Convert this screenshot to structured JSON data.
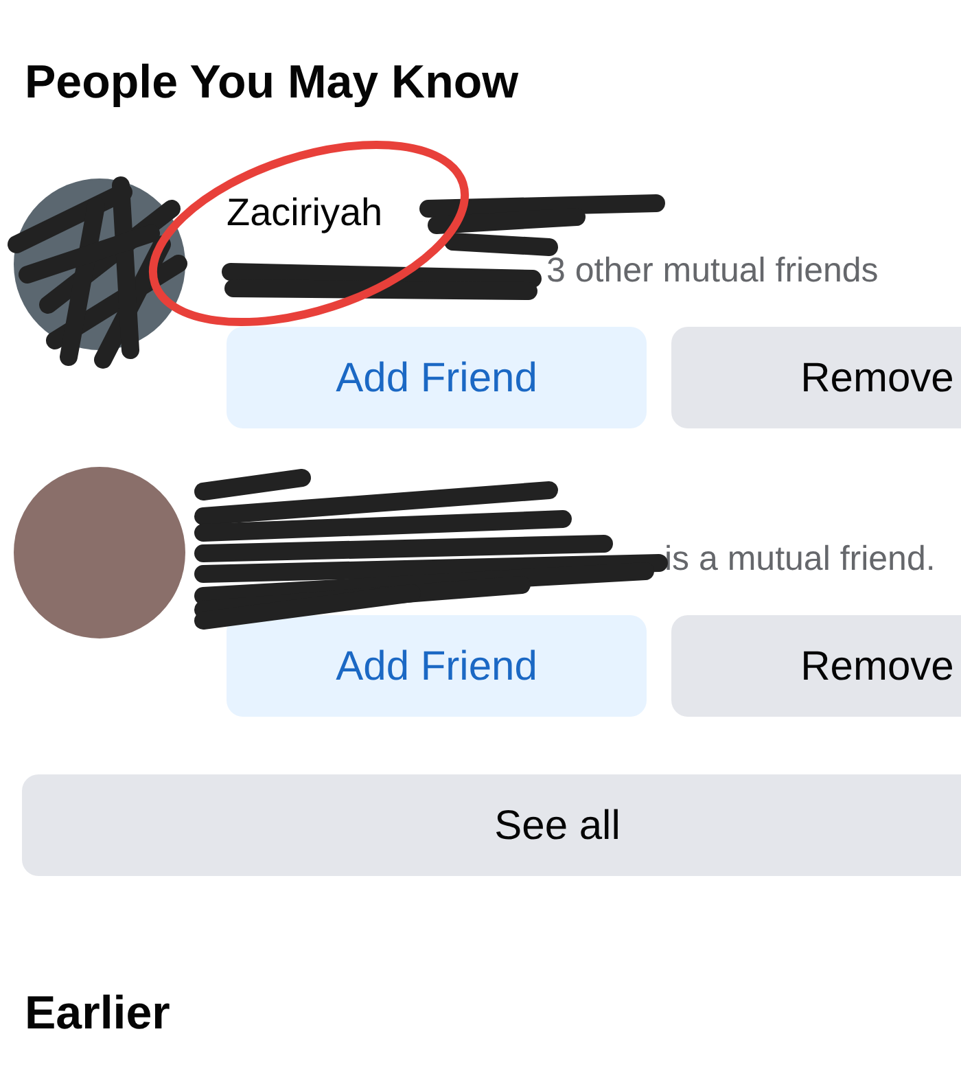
{
  "section_title": "People You May Know",
  "people": [
    {
      "name": "Zaciriyah",
      "mutual": "3 other mutual friends",
      "add_label": "Add Friend",
      "remove_label": "Remove"
    },
    {
      "mutual": "is a mutual friend.",
      "add_label": "Add Friend",
      "remove_label": "Remove"
    }
  ],
  "see_all": "See all",
  "next_section_title": "Earlier"
}
